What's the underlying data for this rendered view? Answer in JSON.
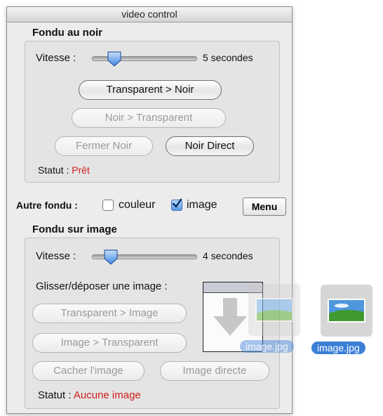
{
  "window": {
    "title": "video control"
  },
  "fade_black": {
    "title": "Fondu au noir",
    "speed_label": "Vitesse :",
    "speed_value": "5 secondes",
    "speed_level": 0.17,
    "btn_transparent_noir": "Transparent > Noir",
    "btn_noir_transparent": "Noir > Transparent",
    "btn_fermer_noir": "Fermer Noir",
    "btn_noir_direct": "Noir Direct",
    "status_label": "Statut :",
    "status_value": "Prêt"
  },
  "other_fade": {
    "label": "Autre fondu :",
    "option_color": "couleur",
    "option_color_checked": false,
    "option_image": "image",
    "option_image_checked": true,
    "menu_label": "Menu"
  },
  "fade_image": {
    "title": "Fondu sur image",
    "speed_label": "Vitesse :",
    "speed_value": "4 secondes",
    "speed_level": 0.13,
    "drop_label": "Glisser/déposer une image :",
    "btn_transparent_image": "Transparent > Image",
    "btn_image_transparent": "Image > Transparent",
    "btn_cacher_image": "Cacher l'image",
    "btn_image_directe": "Image directe",
    "status_label": "Statut :",
    "status_value": "Aucune image"
  },
  "drag": {
    "ghost_filename": "image.jpg",
    "desktop_filename": "image.jpg"
  },
  "colors": {
    "status_red": "#d01b1b",
    "file_label_blue": "#3b7fd6"
  }
}
